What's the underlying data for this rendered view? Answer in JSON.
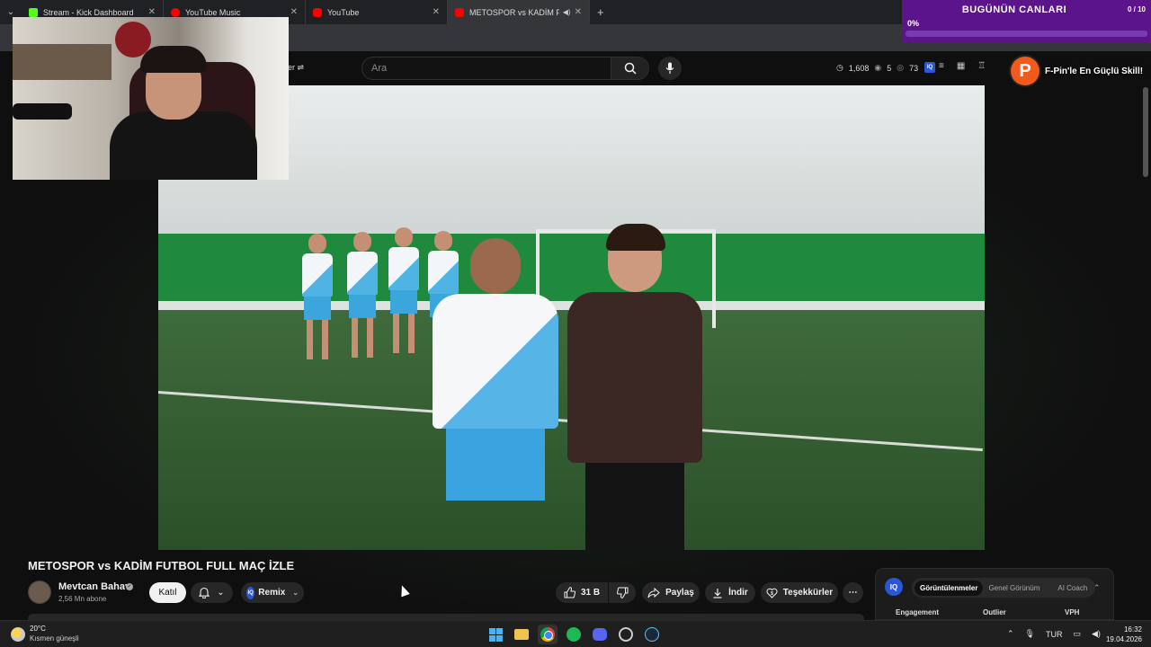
{
  "browser": {
    "tabs": [
      {
        "title": "Stream - Kick Dashboard",
        "icon": "kick-icon",
        "active": false
      },
      {
        "title": "YouTube Music",
        "icon": "youtube-music-icon",
        "active": false
      },
      {
        "title": "YouTube",
        "icon": "youtube-icon",
        "active": false
      },
      {
        "title": "METOSPOR vs KADİM FUTB",
        "icon": "youtube-icon",
        "active": true,
        "audio": true
      }
    ],
    "new_tab_symbol": "+"
  },
  "masthead": {
    "filter_label": "er",
    "search_placeholder": "Ara",
    "stats": {
      "views": "1,608",
      "watchers": "5",
      "eyes": "73"
    },
    "iq_label": "IQ"
  },
  "overlays": {
    "goal_widget": {
      "title": "BUGÜNÜN CANLARI",
      "count": "0 / 10",
      "percent_label": "0%",
      "progress": 0
    },
    "promo": {
      "logo_letter": "P",
      "text": "F-Pin'le En Güçlü Skill!"
    }
  },
  "video": {
    "title": "METOSPOR vs KADİM FUTBOL FULL MAÇ İZLE",
    "channel": {
      "name": "Mevtcan Bahav",
      "subscribers": "2,56 Mn abone"
    },
    "buttons": {
      "join": "Katıl",
      "remix": "Remix",
      "likes": "31 B",
      "share": "Paylaş",
      "download": "İndir",
      "thanks": "Teşekkürler"
    }
  },
  "analytics": {
    "iq_label": "IQ",
    "tabs": [
      "Görüntülenmeler",
      "Genel Görünüm",
      "AI Coach"
    ],
    "columns": [
      "Engagement",
      "Outlier",
      "VPH"
    ]
  },
  "taskbar": {
    "weather": {
      "temp": "20°C",
      "desc": "Kısmen güneşli"
    },
    "language": "TUR",
    "time": "16:32",
    "date": "19.04.2026"
  },
  "colors": {
    "accent_purple": "#5b148a",
    "promo_orange": "#f05a1a",
    "iq_blue": "#2b57d6"
  }
}
